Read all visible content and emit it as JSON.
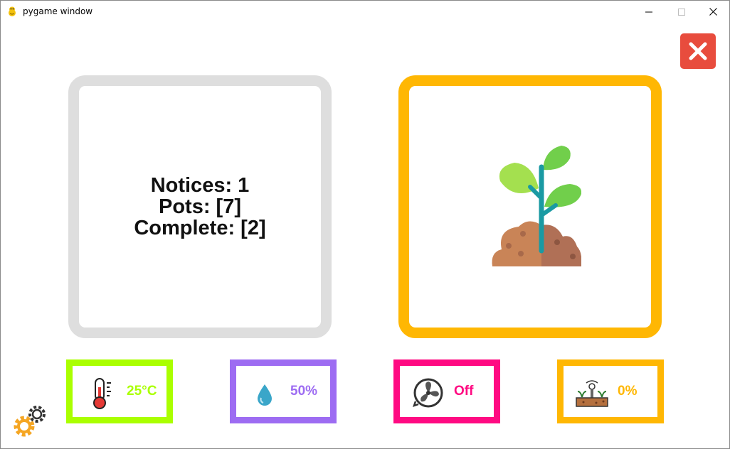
{
  "window": {
    "title": "pygame window"
  },
  "info_panel": {
    "notices": "Notices: 1",
    "pots": "Pots: [7]",
    "complete": "Complete: [2]"
  },
  "plant_panel": {
    "icon": "plant-sprout-icon"
  },
  "sensors": [
    {
      "name": "temperature",
      "icon": "thermometer-icon",
      "value": "25°C",
      "color": "#aaff00"
    },
    {
      "name": "humidity",
      "icon": "water-drop-icon",
      "value": "50%",
      "color": "#9d6cf2"
    },
    {
      "name": "fan",
      "icon": "fan-icon",
      "value": "Off",
      "color": "#ff0a82"
    },
    {
      "name": "soil",
      "icon": "soil-sensor-icon",
      "value": "0%",
      "color": "#ffb703"
    }
  ],
  "colors": {
    "close_button": "#e84c3d",
    "info_border": "#dedede",
    "plant_border": "#ffb703",
    "gear": "#f5a623"
  }
}
